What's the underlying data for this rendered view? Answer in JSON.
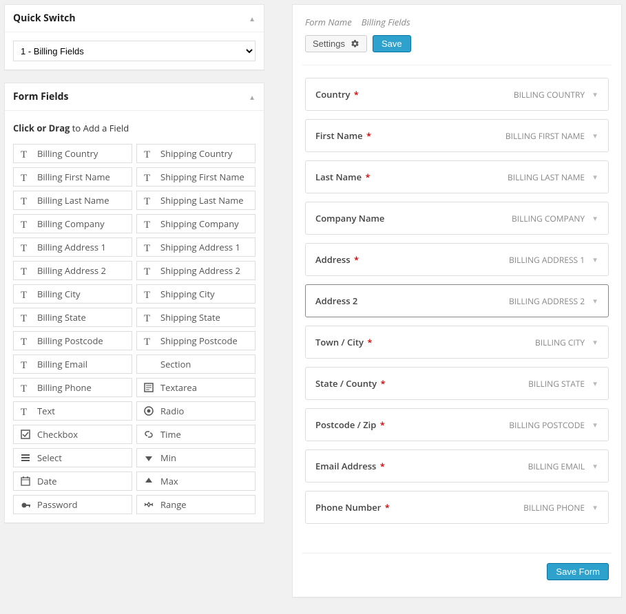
{
  "quick_switch": {
    "title": "Quick Switch",
    "selected": "1 - Billing Fields"
  },
  "form_fields_panel": {
    "title": "Form Fields",
    "hint_bold": "Click or Drag",
    "hint_rest": " to Add a Field",
    "fields": [
      {
        "icon": "text",
        "label": "Billing Country"
      },
      {
        "icon": "text",
        "label": "Shipping Country"
      },
      {
        "icon": "text",
        "label": "Billing First Name"
      },
      {
        "icon": "text",
        "label": "Shipping First Name"
      },
      {
        "icon": "text",
        "label": "Billing Last Name"
      },
      {
        "icon": "text",
        "label": "Shipping Last Name"
      },
      {
        "icon": "text",
        "label": "Billing Company"
      },
      {
        "icon": "text",
        "label": "Shipping Company"
      },
      {
        "icon": "text",
        "label": "Billing Address 1"
      },
      {
        "icon": "text",
        "label": "Shipping Address 1"
      },
      {
        "icon": "text",
        "label": "Billing Address 2"
      },
      {
        "icon": "text",
        "label": "Shipping Address 2"
      },
      {
        "icon": "text",
        "label": "Billing City"
      },
      {
        "icon": "text",
        "label": "Shipping City"
      },
      {
        "icon": "text",
        "label": "Billing State"
      },
      {
        "icon": "text",
        "label": "Shipping State"
      },
      {
        "icon": "text",
        "label": "Billing Postcode"
      },
      {
        "icon": "text",
        "label": "Shipping Postcode"
      },
      {
        "icon": "text",
        "label": "Billing Email"
      },
      {
        "icon": "none",
        "label": "Section"
      },
      {
        "icon": "text",
        "label": "Billing Phone"
      },
      {
        "icon": "textarea",
        "label": "Textarea"
      },
      {
        "icon": "text",
        "label": "Text"
      },
      {
        "icon": "radio",
        "label": "Radio"
      },
      {
        "icon": "checkbox",
        "label": "Checkbox"
      },
      {
        "icon": "link",
        "label": "Time"
      },
      {
        "icon": "select",
        "label": "Select"
      },
      {
        "icon": "down",
        "label": "Min"
      },
      {
        "icon": "date",
        "label": "Date"
      },
      {
        "icon": "up",
        "label": "Max"
      },
      {
        "icon": "password",
        "label": "Password"
      },
      {
        "icon": "range",
        "label": "Range"
      }
    ]
  },
  "form": {
    "meta": {
      "name_label": "Form Name",
      "name_value": "Billing Fields"
    },
    "toolbar": {
      "settings_label": "Settings",
      "save_label": "Save"
    },
    "footer": {
      "save_form_label": "Save Form"
    },
    "rows": [
      {
        "label": "Country",
        "required": true,
        "tag": "BILLING COUNTRY",
        "selected": false
      },
      {
        "label": "First Name",
        "required": true,
        "tag": "BILLING FIRST NAME",
        "selected": false
      },
      {
        "label": "Last Name",
        "required": true,
        "tag": "BILLING LAST NAME",
        "selected": false
      },
      {
        "label": "Company Name",
        "required": false,
        "tag": "BILLING COMPANY",
        "selected": false
      },
      {
        "label": "Address",
        "required": true,
        "tag": "BILLING ADDRESS 1",
        "selected": false
      },
      {
        "label": "Address 2",
        "required": false,
        "tag": "BILLING ADDRESS 2",
        "selected": true
      },
      {
        "label": "Town / City",
        "required": true,
        "tag": "BILLING CITY",
        "selected": false
      },
      {
        "label": "State / County",
        "required": true,
        "tag": "BILLING STATE",
        "selected": false
      },
      {
        "label": "Postcode / Zip",
        "required": true,
        "tag": "BILLING POSTCODE",
        "selected": false
      },
      {
        "label": "Email Address",
        "required": true,
        "tag": "BILLING EMAIL",
        "selected": false
      },
      {
        "label": "Phone Number",
        "required": true,
        "tag": "BILLING PHONE",
        "selected": false
      }
    ]
  }
}
